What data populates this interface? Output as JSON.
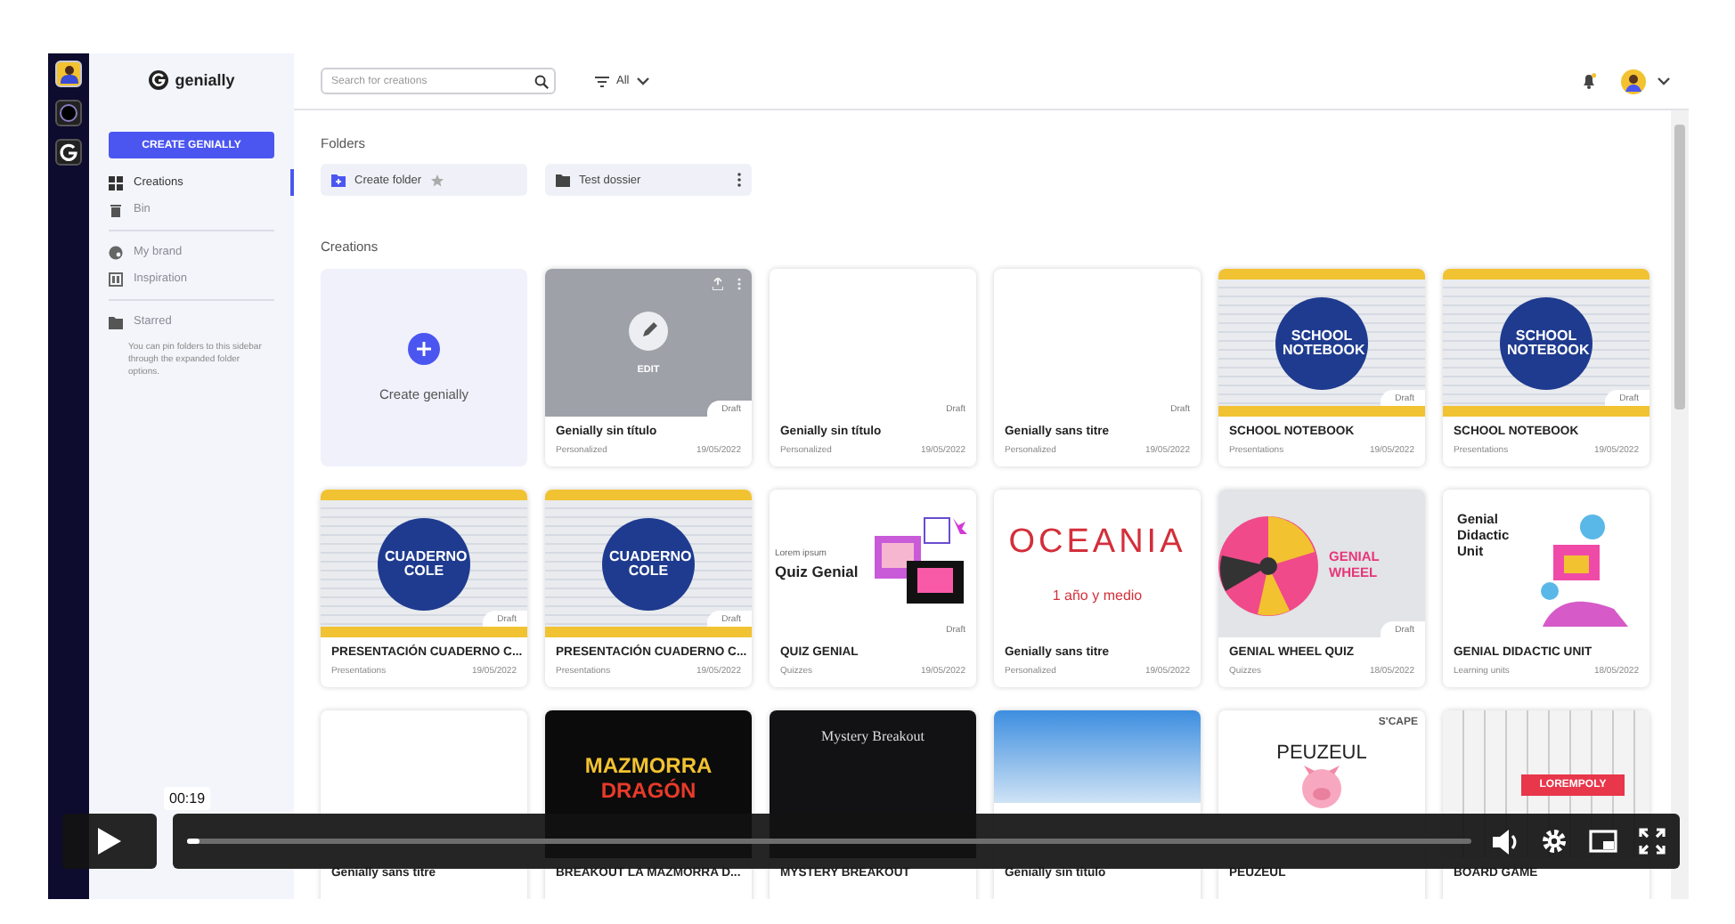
{
  "rail": {
    "apps": [
      {
        "kind": "avatar",
        "selected": true
      },
      {
        "kind": "ring",
        "selected": false
      },
      {
        "kind": "logo",
        "selected": false
      }
    ]
  },
  "sidebar": {
    "logo": "genially",
    "create_button": "CREATE GENIALLY",
    "sections": [
      {
        "items": [
          {
            "label": "Creations",
            "kind": "grid",
            "selected": true
          },
          {
            "label": "Bin",
            "kind": "trash",
            "selected": false
          }
        ]
      },
      {
        "items": [
          {
            "label": "My brand",
            "kind": "palette",
            "selected": false
          },
          {
            "label": "Inspiration",
            "kind": "frame",
            "selected": false
          }
        ]
      },
      {
        "items": [
          {
            "label": "Starred",
            "kind": "folder",
            "selected": false
          }
        ]
      }
    ],
    "help": "You can pin folders to this sidebar through the expanded folder options."
  },
  "topbar": {
    "search": {
      "placeholder": "Search for creations"
    },
    "filter": "All"
  },
  "folders": {
    "heading": "Folders",
    "items": [
      {
        "label": "Create folder",
        "kind": "create"
      },
      {
        "label": "Test dossier",
        "kind": "folder"
      }
    ]
  },
  "creations": {
    "heading": "Creations",
    "create_tile": "Create genially",
    "cards": [
      {
        "title": "Genially sin título",
        "category": "Personalized",
        "date": "19/05/2022",
        "badge": "Draft",
        "overlay_label": "EDIT",
        "thumb": {
          "kind": "blank"
        }
      },
      {
        "title": "Genially sin título",
        "category": "Personalized",
        "date": "19/05/2022",
        "badge": "Draft",
        "thumb": {
          "kind": "blank"
        }
      },
      {
        "title": "Genially sans titre",
        "category": "Personalized",
        "date": "19/05/2022",
        "badge": "Draft",
        "thumb": {
          "kind": "blank"
        }
      },
      {
        "title": "SCHOOL NOTEBOOK",
        "category": "Presentations",
        "date": "19/05/2022",
        "badge": "Draft",
        "thumb": {
          "kind": "notebook",
          "texts": [
            "SCHOOL NOTEBOOK"
          ]
        }
      },
      {
        "title": "SCHOOL NOTEBOOK",
        "category": "Presentations",
        "date": "19/05/2022",
        "badge": "Draft",
        "thumb": {
          "kind": "notebook",
          "texts": [
            "SCHOOL NOTEBOOK"
          ]
        }
      },
      {
        "title": "PRESENTACIÓN CUADERNO C...",
        "category": "Presentations",
        "date": "19/05/2022",
        "badge": "Draft",
        "thumb": {
          "kind": "notebook",
          "texts": [
            "CUADERNO COLE"
          ]
        }
      },
      {
        "title": "PRESENTACIÓN CUADERNO C...",
        "category": "Presentations",
        "date": "19/05/2022",
        "badge": "Draft",
        "thumb": {
          "kind": "notebook",
          "texts": [
            "CUADERNO COLE"
          ]
        }
      },
      {
        "title": "QUIZ GENIAL",
        "category": "Quizzes",
        "date": "19/05/2022",
        "badge": "Draft",
        "thumb": {
          "kind": "quiz",
          "texts": [
            "Lorem ipsum",
            "Quiz Genial"
          ]
        }
      },
      {
        "title": "Genially sans titre",
        "category": "Personalized",
        "date": "19/05/2022",
        "thumb": {
          "kind": "poster",
          "texts": [
            "OCEANIA",
            "1 año y medio"
          ]
        }
      },
      {
        "title": "GENIAL WHEEL QUIZ",
        "category": "Quizzes",
        "date": "18/05/2022",
        "badge": "Draft",
        "thumb": {
          "kind": "wheel",
          "texts": [
            "GENIAL WHEEL"
          ]
        }
      },
      {
        "title": "GENIAL DIDACTIC UNIT",
        "category": "Learning units",
        "date": "18/05/2022",
        "thumb": {
          "kind": "didactic",
          "texts": [
            "Genial Didactic Unit"
          ]
        }
      },
      {
        "title": "Genially sans titre",
        "thumb": {
          "kind": "blank"
        }
      },
      {
        "title": "BREAKOUT LA MAZMORRA D...",
        "thumb": {
          "kind": "dungeon",
          "texts": [
            "MAZMORRA",
            "DRAGÓN"
          ]
        }
      },
      {
        "title": "MYSTERY BREAKOUT",
        "thumb": {
          "kind": "dark",
          "texts": [
            "Mystery Breakout"
          ]
        }
      },
      {
        "title": "Genially sin título",
        "thumb": {
          "kind": "photo"
        }
      },
      {
        "title": "PEUZEUL",
        "thumb": {
          "kind": "peuzeul",
          "texts": [
            "S'CAPE",
            "PEUZEUL"
          ]
        }
      },
      {
        "title": "BOARD GAME",
        "thumb": {
          "kind": "board",
          "texts": [
            "LOREMPOLY"
          ]
        }
      }
    ]
  },
  "player": {
    "time_tooltip": "00:19",
    "level": 0.01
  }
}
